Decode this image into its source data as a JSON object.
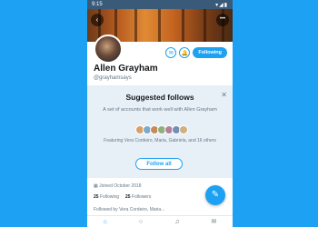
{
  "statusbar": {
    "time": "9:15",
    "icons": "▾◢▮"
  },
  "header": {
    "back_icon": "‹",
    "more_icon": "•••"
  },
  "profile": {
    "name": "Allen Grayham",
    "handle": "@grayhamsays",
    "follow_label": "Following",
    "message_icon": "✉",
    "notify_icon": "🔔"
  },
  "suggested": {
    "title": "Suggested follows",
    "close_icon": "✕",
    "description": "A set of accounts that work well with Allen Grayham",
    "featuring": "Featuring Vera Cordeiro, Maria, Gabriela, and 16 others",
    "follow_all_label": "Follow all",
    "avatar_colors": [
      "#d9a066",
      "#7aa9c9",
      "#c48a5a",
      "#8fb07a",
      "#b57f9a",
      "#6f8fb5",
      "#d0b080"
    ]
  },
  "info": {
    "joined": "Joined October 2018",
    "following_count": "25",
    "following_label": "Following",
    "followers_count": "25",
    "followers_label": "Followers",
    "followed_by": "Followed by Vera Cordeiro, Maria..."
  },
  "fab_icon": "✎",
  "nav": {
    "home": "⌂",
    "search": "○",
    "notifications": "♫",
    "messages": "✉"
  },
  "colors": {
    "brand": "#1da1f2",
    "card_bg": "#e8f0f7"
  }
}
